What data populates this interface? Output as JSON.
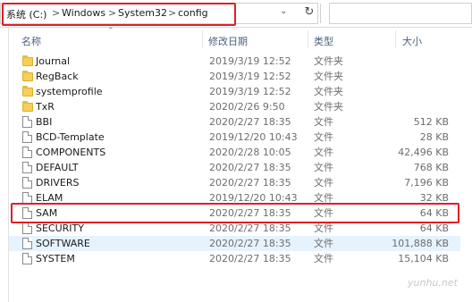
{
  "breadcrumb": {
    "drive": "系统 (C:)",
    "folder1": "Windows",
    "folder2": "System32",
    "folder3": "config",
    "separator": ">"
  },
  "toolbar": {
    "dropdown_icon": "chevron-down-icon",
    "refresh_icon": "refresh-icon"
  },
  "columns": {
    "name": "名称",
    "modified": "修改日期",
    "type": "类型",
    "size": "大小"
  },
  "highlight_color": "#e01e26",
  "rows": [
    {
      "name": "Journal",
      "date": "2019/3/19 12:52",
      "type": "文件夹",
      "size": "",
      "kind": "folder"
    },
    {
      "name": "RegBack",
      "date": "2019/3/19 12:52",
      "type": "文件夹",
      "size": "",
      "kind": "folder"
    },
    {
      "name": "systemprofile",
      "date": "2019/3/19 12:52",
      "type": "文件夹",
      "size": "",
      "kind": "folder"
    },
    {
      "name": "TxR",
      "date": "2020/2/26 9:50",
      "type": "文件夹",
      "size": "",
      "kind": "folder"
    },
    {
      "name": "BBI",
      "date": "2020/2/27 18:35",
      "type": "文件",
      "size": "512 KB",
      "kind": "file"
    },
    {
      "name": "BCD-Template",
      "date": "2019/12/20 10:43",
      "type": "文件",
      "size": "28 KB",
      "kind": "file"
    },
    {
      "name": "COMPONENTS",
      "date": "2020/2/28 10:05",
      "type": "文件",
      "size": "42,496 KB",
      "kind": "file"
    },
    {
      "name": "DEFAULT",
      "date": "2020/2/27 18:35",
      "type": "文件",
      "size": "768 KB",
      "kind": "file"
    },
    {
      "name": "DRIVERS",
      "date": "2020/2/27 18:35",
      "type": "文件",
      "size": "7,196 KB",
      "kind": "file"
    },
    {
      "name": "ELAM",
      "date": "2019/12/20 10:43",
      "type": "文件",
      "size": "32 KB",
      "kind": "file"
    },
    {
      "name": "SAM",
      "date": "2020/2/27 18:35",
      "type": "文件",
      "size": "64 KB",
      "kind": "file"
    },
    {
      "name": "SECURITY",
      "date": "2020/2/27 18:35",
      "type": "文件",
      "size": "64 KB",
      "kind": "file"
    },
    {
      "name": "SOFTWARE",
      "date": "2020/2/27 18:35",
      "type": "文件",
      "size": "101,888 KB",
      "kind": "file"
    },
    {
      "name": "SYSTEM",
      "date": "2020/2/27 18:35",
      "type": "文件",
      "size": "15,104 KB",
      "kind": "file"
    }
  ],
  "watermark": "yunhu.net"
}
